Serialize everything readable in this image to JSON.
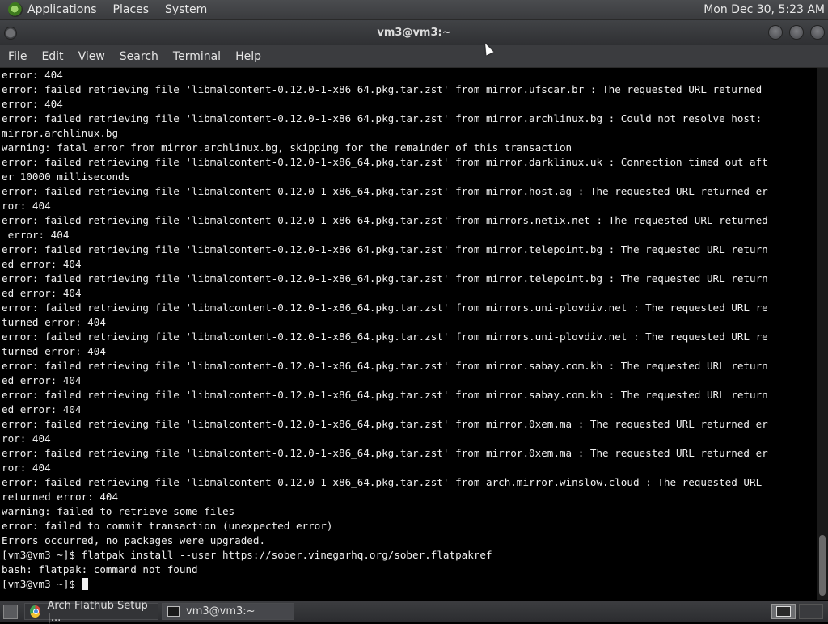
{
  "top_panel": {
    "menus": [
      "Applications",
      "Places",
      "System"
    ],
    "clock": "Mon Dec 30, 5:23 AM"
  },
  "window": {
    "title": "vm3@vm3:~"
  },
  "menubar": {
    "items": [
      "File",
      "Edit",
      "View",
      "Search",
      "Terminal",
      "Help"
    ]
  },
  "terminal": {
    "lines": [
      "error: 404",
      "error: failed retrieving file 'libmalcontent-0.12.0-1-x86_64.pkg.tar.zst' from mirror.ufscar.br : The requested URL returned",
      "error: 404",
      "error: failed retrieving file 'libmalcontent-0.12.0-1-x86_64.pkg.tar.zst' from mirror.archlinux.bg : Could not resolve host:",
      "mirror.archlinux.bg",
      "warning: fatal error from mirror.archlinux.bg, skipping for the remainder of this transaction",
      "error: failed retrieving file 'libmalcontent-0.12.0-1-x86_64.pkg.tar.zst' from mirror.darklinux.uk : Connection timed out aft",
      "er 10000 milliseconds",
      "error: failed retrieving file 'libmalcontent-0.12.0-1-x86_64.pkg.tar.zst' from mirror.host.ag : The requested URL returned er",
      "ror: 404",
      "error: failed retrieving file 'libmalcontent-0.12.0-1-x86_64.pkg.tar.zst' from mirrors.netix.net : The requested URL returned",
      " error: 404",
      "error: failed retrieving file 'libmalcontent-0.12.0-1-x86_64.pkg.tar.zst' from mirror.telepoint.bg : The requested URL return",
      "ed error: 404",
      "error: failed retrieving file 'libmalcontent-0.12.0-1-x86_64.pkg.tar.zst' from mirror.telepoint.bg : The requested URL return",
      "ed error: 404",
      "error: failed retrieving file 'libmalcontent-0.12.0-1-x86_64.pkg.tar.zst' from mirrors.uni-plovdiv.net : The requested URL re",
      "turned error: 404",
      "error: failed retrieving file 'libmalcontent-0.12.0-1-x86_64.pkg.tar.zst' from mirrors.uni-plovdiv.net : The requested URL re",
      "turned error: 404",
      "error: failed retrieving file 'libmalcontent-0.12.0-1-x86_64.pkg.tar.zst' from mirror.sabay.com.kh : The requested URL return",
      "ed error: 404",
      "error: failed retrieving file 'libmalcontent-0.12.0-1-x86_64.pkg.tar.zst' from mirror.sabay.com.kh : The requested URL return",
      "ed error: 404",
      "error: failed retrieving file 'libmalcontent-0.12.0-1-x86_64.pkg.tar.zst' from mirror.0xem.ma : The requested URL returned er",
      "ror: 404",
      "error: failed retrieving file 'libmalcontent-0.12.0-1-x86_64.pkg.tar.zst' from mirror.0xem.ma : The requested URL returned er",
      "ror: 404",
      "error: failed retrieving file 'libmalcontent-0.12.0-1-x86_64.pkg.tar.zst' from arch.mirror.winslow.cloud : The requested URL",
      "returned error: 404",
      "warning: failed to retrieve some files",
      "error: failed to commit transaction (unexpected error)",
      "Errors occurred, no packages were upgraded.",
      "[vm3@vm3 ~]$ flatpak install --user https://sober.vinegarhq.org/sober.flatpakref",
      "bash: flatpak: command not found"
    ],
    "prompt": "[vm3@vm3 ~]$ "
  },
  "taskbar": {
    "tasks": [
      "Arch Flathub Setup |...",
      "vm3@vm3:~"
    ]
  }
}
